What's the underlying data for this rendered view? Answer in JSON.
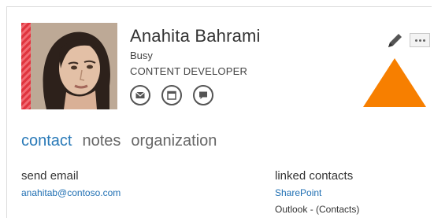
{
  "contact": {
    "name": "Anahita Bahrami",
    "status": "Busy",
    "title": "CONTENT DEVELOPER",
    "presence_color": "#e0343e"
  },
  "actions": [
    {
      "icon": "mail-icon"
    },
    {
      "icon": "calendar-icon"
    },
    {
      "icon": "chat-icon"
    }
  ],
  "tabs": [
    {
      "label": "contact",
      "active": true
    },
    {
      "label": "notes",
      "active": false
    },
    {
      "label": "organization",
      "active": false
    }
  ],
  "send_email": {
    "label": "send email",
    "address": "anahitab@contoso.com"
  },
  "linked_contacts": {
    "label": "linked contacts",
    "items": [
      "SharePoint",
      "Outlook - (Contacts)"
    ]
  },
  "colors": {
    "accent": "#2a7ab8",
    "triangle": "#f77f00"
  }
}
